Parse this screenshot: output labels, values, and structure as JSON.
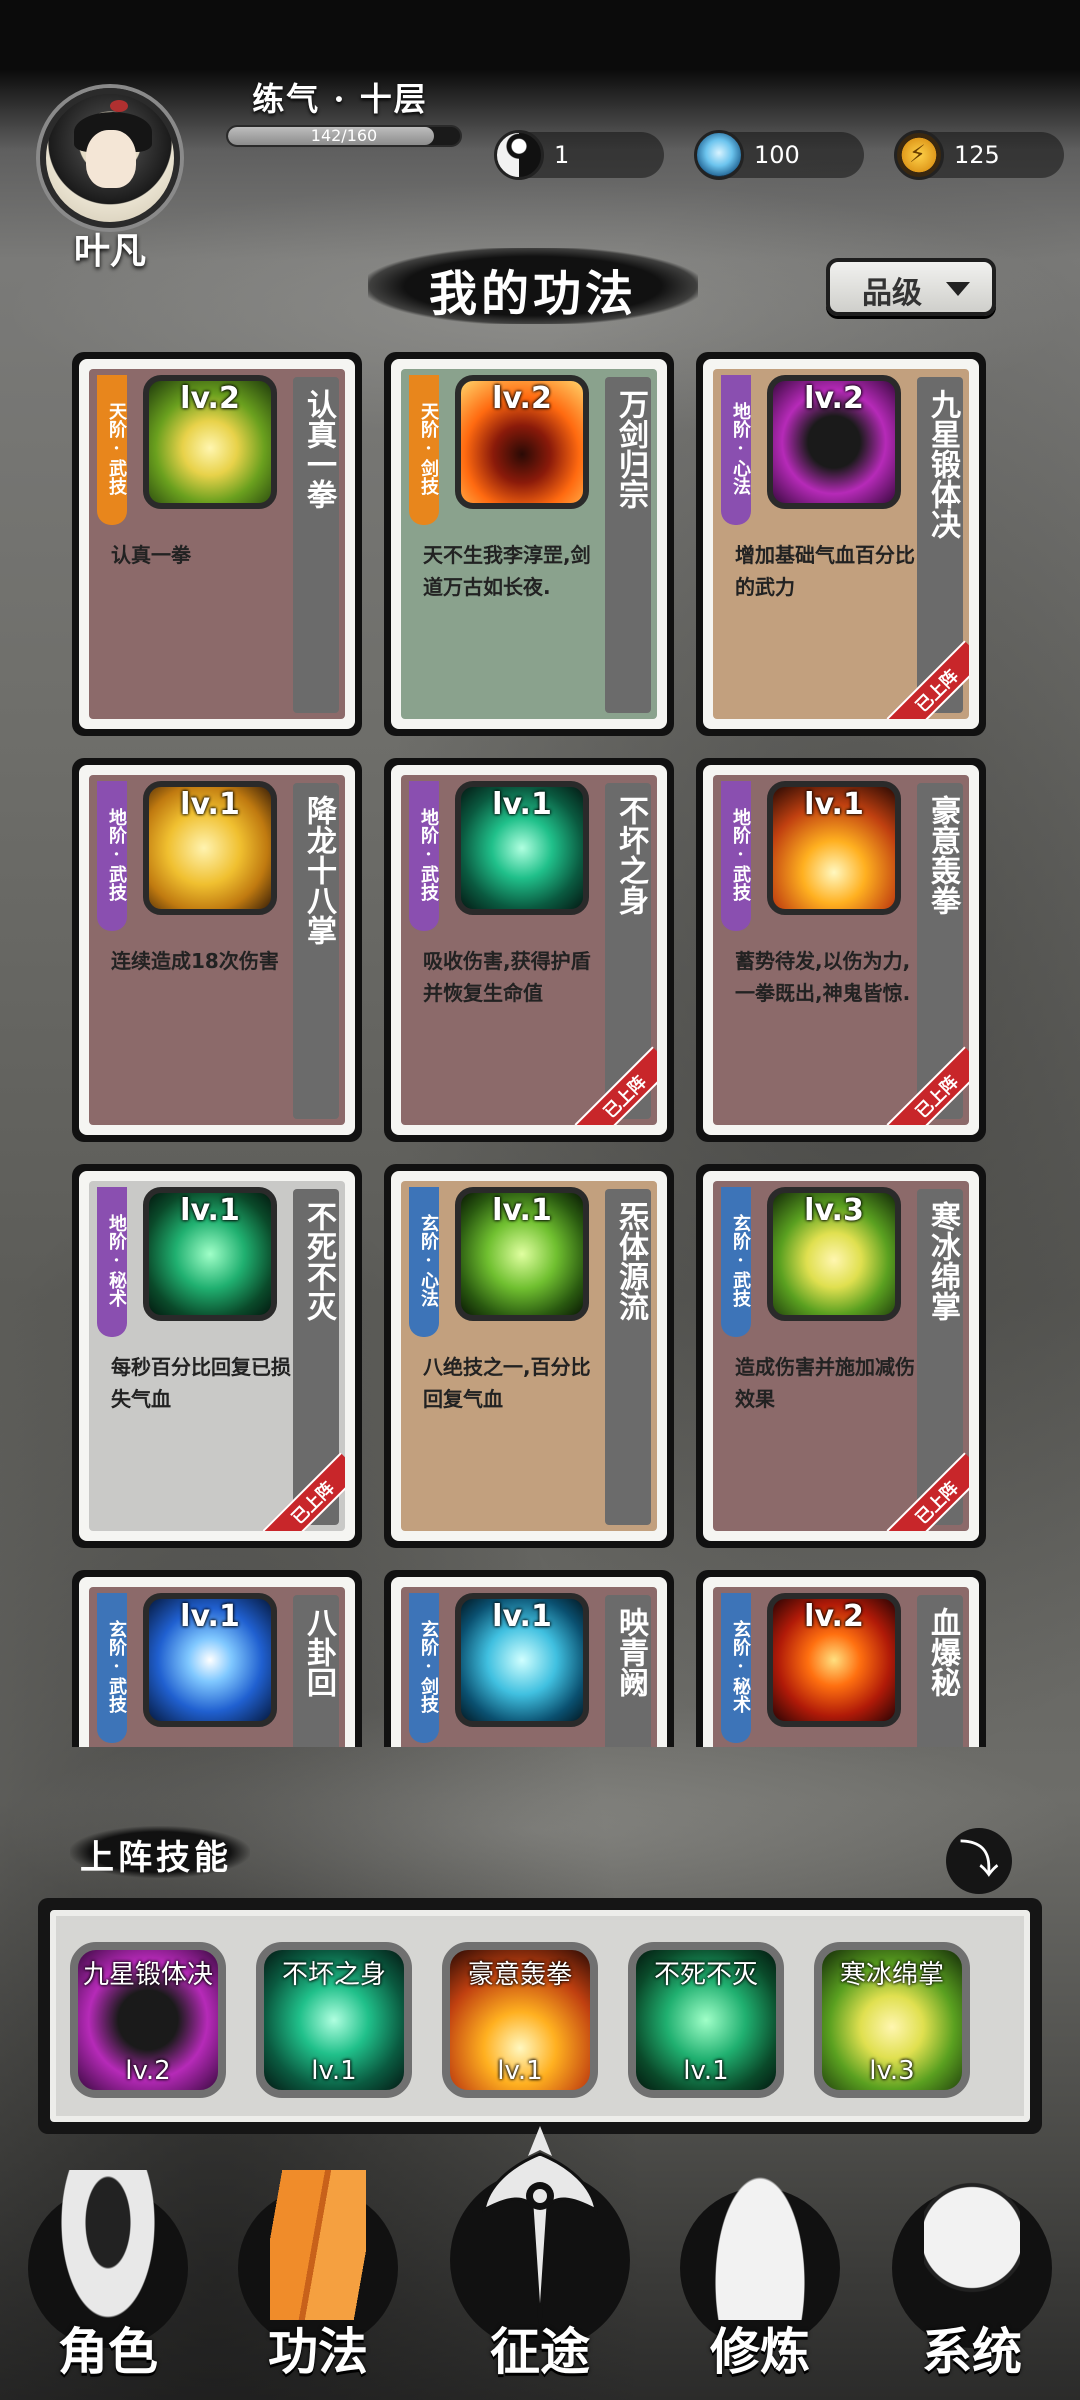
{
  "player": {
    "name": "叶凡",
    "realm": "练气 · 十层",
    "exp_text": "142/160",
    "exp_fraction": 0.8875
  },
  "resources": [
    {
      "icon": "yin-yang-icon",
      "value": "1"
    },
    {
      "icon": "spirit-stone-icon",
      "value": "100"
    },
    {
      "icon": "lightning-energy-icon",
      "value": "125"
    }
  ],
  "page_title": "我的功法",
  "filter": {
    "label": "品级"
  },
  "skills": [
    {
      "tag": "天阶·武技",
      "tag_color": "#e8861c",
      "level": "lv.2",
      "name": "认真一拳",
      "desc": "认真一拳",
      "bg": "#8c6a6a",
      "art": "fist-gold-icon",
      "equipped": false
    },
    {
      "tag": "天阶·剑技",
      "tag_color": "#e8861c",
      "level": "lv.2",
      "name": "万剑归宗",
      "desc": "天不生我李淳罡,剑道万古如长夜.",
      "bg": "#8aa28d",
      "art": "flame-swordsman-icon",
      "equipped": false
    },
    {
      "tag": "地阶·心法",
      "tag_color": "#8a4fb0",
      "level": "lv.2",
      "name": "九星锻体决",
      "desc": "增加基础气血百分比的武力",
      "bg": "#c2a07e",
      "art": "dark-figure-icon",
      "equipped": true
    },
    {
      "tag": "地阶·武技",
      "tag_color": "#8a4fb0",
      "level": "lv.1",
      "name": "降龙十八掌",
      "desc": "连续造成18次伤害",
      "bg": "#8c6a6a",
      "art": "golden-palm-icon",
      "equipped": false
    },
    {
      "tag": "地阶·武技",
      "tag_color": "#8a4fb0",
      "level": "lv.1",
      "name": "不坏之身",
      "desc": "吸收伤害,获得护盾并恢复生命值",
      "bg": "#8c6a6a",
      "art": "jade-aura-icon",
      "equipped": true
    },
    {
      "tag": "地阶·武技",
      "tag_color": "#8a4fb0",
      "level": "lv.1",
      "name": "豪意轰拳",
      "desc": "蓄势待发,以伤为力,一拳既出,神鬼皆惊.",
      "bg": "#8c6a6a",
      "art": "fire-burst-icon",
      "equipped": true
    },
    {
      "tag": "地阶·秘术",
      "tag_color": "#8a4fb0",
      "level": "lv.1",
      "name": "不死不灭",
      "desc": "每秒百分比回复已损失气血",
      "bg": "#c9c9c7",
      "art": "green-spirit-icon",
      "equipped": true
    },
    {
      "tag": "玄阶·心法",
      "tag_color": "#3d74b8",
      "level": "lv.1",
      "name": "炁体源流",
      "desc": "八绝技之一,百分比回复气血",
      "bg": "#c2a07e",
      "art": "green-dragon-icon",
      "equipped": false
    },
    {
      "tag": "玄阶·武技",
      "tag_color": "#3d74b8",
      "level": "lv.3",
      "name": "寒冰绵掌",
      "desc": "造成伤害并施加减伤效果",
      "bg": "#8c6a6a",
      "art": "fist-green-icon",
      "equipped": true
    },
    {
      "tag": "玄阶·武技",
      "tag_color": "#3d74b8",
      "level": "lv.1",
      "name": "八卦回",
      "desc": "",
      "bg": "#8c6a6a",
      "art": "blue-orb-icon",
      "equipped": false
    },
    {
      "tag": "玄阶·剑技",
      "tag_color": "#3d74b8",
      "level": "lv.1",
      "name": "映青阙",
      "desc": "",
      "bg": "#8c6a6a",
      "art": "cyan-blade-icon",
      "equipped": false
    },
    {
      "tag": "玄阶·秘术",
      "tag_color": "#3d74b8",
      "level": "lv.2",
      "name": "血爆秘",
      "desc": "",
      "bg": "#8c6a6a",
      "art": "blood-fire-icon",
      "equipped": false
    }
  ],
  "equipped_label": "已上阵",
  "battle_skills": {
    "title": "上阵技能",
    "slots": [
      {
        "name": "九星锻体决",
        "level": "lv.2",
        "art": "dark-figure-icon"
      },
      {
        "name": "不坏之身",
        "level": "lv.1",
        "art": "jade-aura-icon"
      },
      {
        "name": "豪意轰拳",
        "level": "lv.1",
        "art": "fire-burst-icon"
      },
      {
        "name": "不死不灭",
        "level": "lv.1",
        "art": "green-spirit-icon"
      },
      {
        "name": "寒冰绵掌",
        "level": "lv.3",
        "art": "fist-green-icon"
      }
    ]
  },
  "nav": [
    {
      "label": "角色",
      "icon": "hooded-figure-icon"
    },
    {
      "label": "功法",
      "icon": "scroll-books-icon"
    },
    {
      "label": "征途",
      "icon": "sword-emblem-icon"
    },
    {
      "label": "修炼",
      "icon": "meditating-monk-icon"
    },
    {
      "label": "系统",
      "icon": "panda-girl-icon"
    }
  ]
}
